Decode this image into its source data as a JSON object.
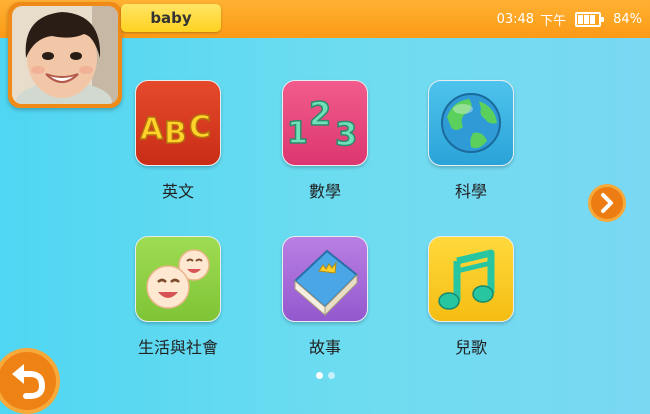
{
  "header": {
    "profile_name": "baby",
    "time": "03:48",
    "ampm": "下午",
    "battery_percent": "84%",
    "battery_level": 0.84
  },
  "apps": [
    {
      "label": "英文",
      "icon": "abc-letters-icon"
    },
    {
      "label": "數學",
      "icon": "numbers-123-icon"
    },
    {
      "label": "科學",
      "icon": "globe-icon"
    },
    {
      "label": "生活與社會",
      "icon": "smiley-faces-icon"
    },
    {
      "label": "故事",
      "icon": "storybook-icon"
    },
    {
      "label": "兒歌",
      "icon": "music-note-icon"
    }
  ],
  "pager": {
    "page": 1,
    "total": 2
  },
  "colors": {
    "header": "#fb9a16",
    "background": "#4fd6f2",
    "accent": "#ef8214"
  }
}
